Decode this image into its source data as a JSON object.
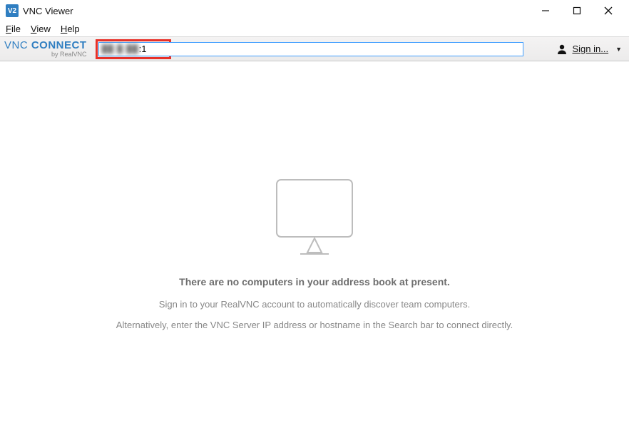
{
  "titlebar": {
    "app_badge": "V2",
    "title": "VNC Viewer"
  },
  "menubar": {
    "file": "File",
    "view": "View",
    "help": "Help"
  },
  "toolbar": {
    "brand_vnc": "VNC",
    "brand_connect": "CONNECT",
    "brand_sub": "by RealVNC",
    "address_value": ":1",
    "signin_label": "Sign in..."
  },
  "content": {
    "headline": "There are no computers in your address book at present.",
    "line1": "Sign in to your RealVNC account to automatically discover team computers.",
    "line2": "Alternatively, enter the VNC Server IP address or hostname in the Search bar to connect directly."
  }
}
